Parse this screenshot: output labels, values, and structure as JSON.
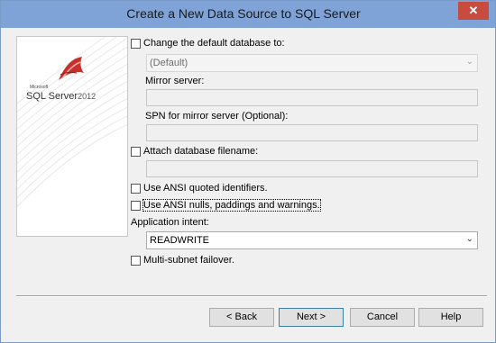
{
  "window": {
    "title": "Create a New Data Source to SQL Server",
    "close_symbol": "✕"
  },
  "logo": {
    "microsoft_label": "Microsoft",
    "product": "SQL Server",
    "year": "2012"
  },
  "options": {
    "change_default_db": {
      "label": "Change the default database to:",
      "checked": false
    },
    "default_db": {
      "value": "(Default)",
      "enabled": false
    },
    "mirror_server": {
      "label": "Mirror server:",
      "value": ""
    },
    "spn_mirror": {
      "label": "SPN for mirror server (Optional):",
      "value": ""
    },
    "attach_db": {
      "label": "Attach database filename:",
      "checked": false,
      "value": ""
    },
    "ansi_quoted": {
      "label": "Use ANSI quoted identifiers.",
      "checked": false
    },
    "ansi_nulls": {
      "label": "Use ANSI nulls, paddings and warnings.",
      "checked": false
    },
    "app_intent": {
      "label": "Application intent:",
      "value": "READWRITE"
    },
    "multi_subnet": {
      "label": "Multi-subnet failover.",
      "checked": false
    }
  },
  "buttons": {
    "back": "< Back",
    "next": "Next >",
    "cancel": "Cancel",
    "help": "Help"
  },
  "colors": {
    "titlebar": "#7fa3d6",
    "close": "#c74b3e",
    "background": "#f0f0f0"
  }
}
